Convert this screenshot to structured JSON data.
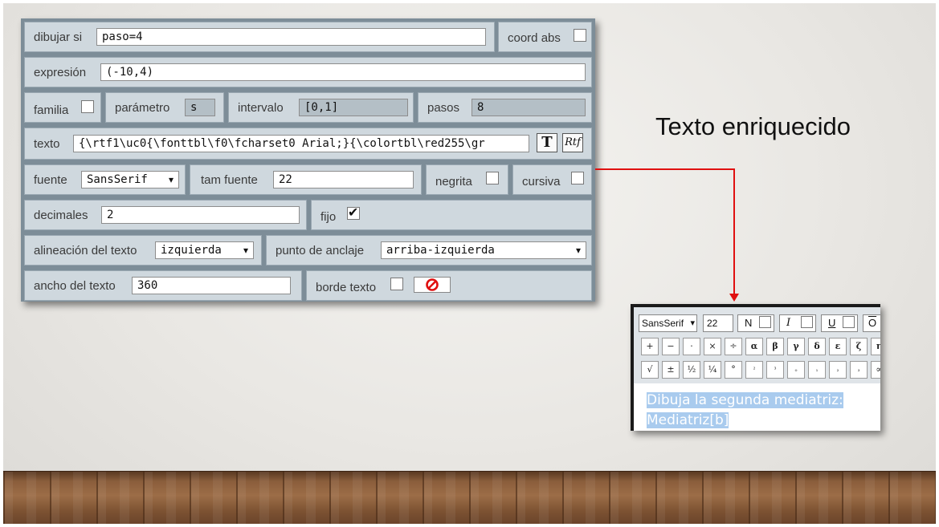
{
  "slide_title": "Texto enriquecido",
  "colors": {
    "arrow": "#e01010",
    "panel": "#7d8d98",
    "field_bg": "#cfd8de",
    "selection": "#a9cbee"
  },
  "dialog": {
    "draw_if": {
      "label": "dibujar si",
      "value": "paso=4"
    },
    "coord_abs": {
      "label": "coord abs",
      "checked": false
    },
    "expression": {
      "label": "expresión",
      "value": "(-10,4)"
    },
    "family": {
      "label": "familia",
      "checked": false
    },
    "parameter": {
      "label": "parámetro",
      "value": "s"
    },
    "interval": {
      "label": "intervalo",
      "value": "[0,1]"
    },
    "steps": {
      "label": "pasos",
      "value": "8"
    },
    "text": {
      "label": "texto",
      "value": "{\\rtf1\\uc0{\\fonttbl\\f0\\fcharset0 Arial;}{\\colortbl\\red255\\gr",
      "t_button": "T",
      "rtf_button": "Rtf"
    },
    "font": {
      "label": "fuente",
      "value": "SansSerif"
    },
    "font_size": {
      "label": "tam fuente",
      "value": "22"
    },
    "bold": {
      "label": "negrita",
      "checked": false
    },
    "italic": {
      "label": "cursiva",
      "checked": false
    },
    "decimals": {
      "label": "decimales",
      "value": "2"
    },
    "fixed": {
      "label": "fijo",
      "checked": true
    },
    "text_align": {
      "label": "alineación del texto",
      "value": "izquierda"
    },
    "anchor": {
      "label": "punto de anclaje",
      "value": "arriba-izquierda"
    },
    "text_width": {
      "label": "ancho del texto",
      "value": "360"
    },
    "text_border": {
      "label": "borde texto",
      "checked": false,
      "color_icon": "no-color-icon"
    }
  },
  "editor": {
    "font": "SansSerif",
    "size": "22",
    "bold_label": "N",
    "italic_label": "I",
    "underline_label": "U",
    "overline_label": "O",
    "row1": [
      "+",
      "−",
      "·",
      "×",
      "÷",
      "α",
      "β",
      "γ",
      "δ",
      "ε",
      "ζ",
      "η"
    ],
    "row2": [
      "√",
      "±",
      "½",
      "¼",
      "°",
      "²",
      "³",
      "₀",
      "₁",
      "₂",
      "₃",
      "∞"
    ],
    "text_line1": "Dibuja la segunda mediatriz:",
    "text_line2": "Mediatriz[b]"
  }
}
